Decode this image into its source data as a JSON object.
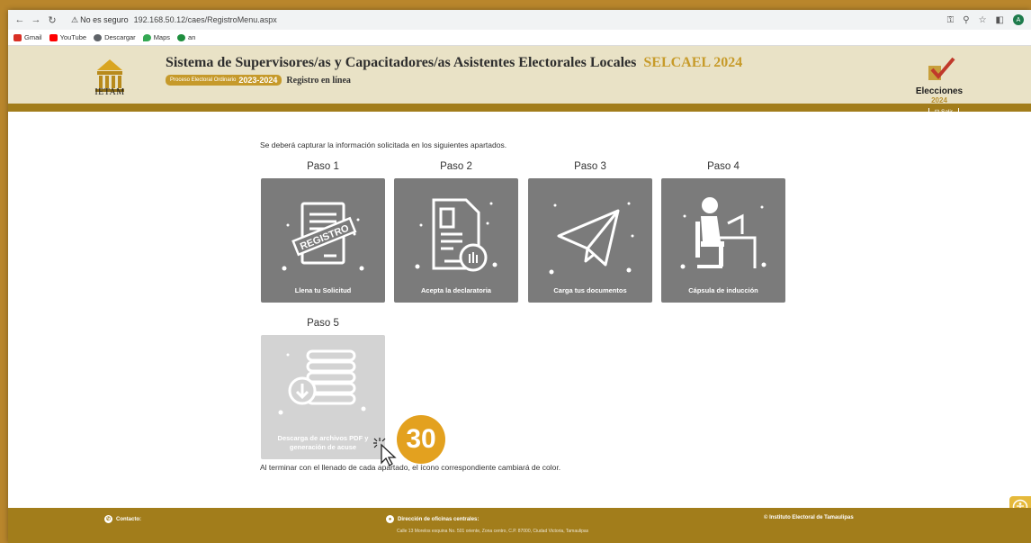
{
  "browser": {
    "security_label": "No es seguro",
    "url": "192.168.50.12/caes/RegistroMenu.aspx",
    "profile_initial": "A"
  },
  "bookmarks": [
    "Gmail",
    "YouTube",
    "Descargar",
    "Maps",
    "an"
  ],
  "header": {
    "title": "Sistema de Supervisores/as y Capacitadores/as Asistentes Electorales Locales",
    "title_suffix": "SELCAEL 2024",
    "process_label": "Proceso Electoral Ordinario",
    "process_year": "2023-2024",
    "subtitle": "Registro en línea",
    "org_logo_text": "IETAM",
    "elections_word": "Elecciones",
    "elections_year": "2024",
    "logout_label": "Salir"
  },
  "main": {
    "intro": "Se deberá capturar la información solicitada en los siguientes apartados.",
    "steps": [
      {
        "label": "Paso 1",
        "caption": "Llena tu Solicitud",
        "icon": "registro-form-icon",
        "enabled": true
      },
      {
        "label": "Paso 2",
        "caption": "Acepta la declaratoria",
        "icon": "declaration-document-icon",
        "enabled": true
      },
      {
        "label": "Paso 3",
        "caption": "Carga tus documentos",
        "icon": "paper-plane-icon",
        "enabled": true
      },
      {
        "label": "Paso 4",
        "caption": "Cápsula de inducción",
        "icon": "person-at-desk-icon",
        "enabled": true
      },
      {
        "label": "Paso 5",
        "caption": "Descarga de archivos PDF y generación de acuse",
        "icon": "download-stack-icon",
        "enabled": false
      }
    ],
    "closing": "Al terminar con el llenado de cada apartado, el ícono correspondiente cambiará de color.",
    "annotation_badge": "30"
  },
  "footer": {
    "contact_label": "Contacto:",
    "address_label": "Dirección de oficinas centrales:",
    "address_text": "Calle 13 Morelos esquina No. 501 oriente, Zona centro, C.P. 87000, Ciudad Victoria, Tamaulipas",
    "copyright": "© Instituto Electoral de Tamaulipas"
  },
  "colors": {
    "header_bg": "#e9e2c6",
    "brand_gold": "#a27d1b",
    "card_active": "#7b7b7b",
    "card_disabled": "#d3d3d3",
    "badge": "#e3a11f"
  }
}
